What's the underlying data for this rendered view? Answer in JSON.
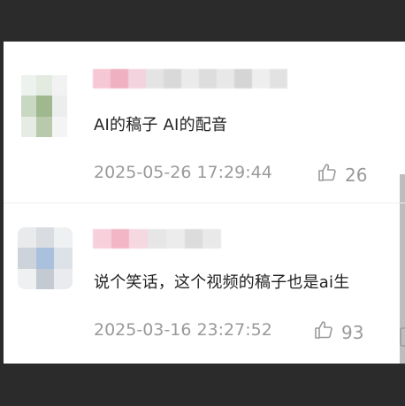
{
  "comments": [
    {
      "text": "AI的稿子 AI的配音",
      "timestamp": "2025-05-26 17:29:44",
      "likes": "26",
      "avatar_colors": [
        "#eef2ee",
        "#e3eadf",
        "#f2f2f2",
        "#c9d8c3",
        "#9fb88d",
        "#eceeed",
        "#e6ece4",
        "#b8c9ac",
        "#f4f4f4"
      ],
      "name_colors": [
        "#f6c7d4",
        "#efb0c2",
        "#f3d3dd",
        "#e4e4e4",
        "#d9d9d9",
        "#ebebeb",
        "#dddddd",
        "#e8e8e8",
        "#d5d5d5",
        "#eeeeee",
        "#e2e2e2"
      ]
    },
    {
      "text": "说个笑话，这个视频的稿子也是ai生",
      "timestamp": "2025-03-16 23:27:52",
      "likes": "93",
      "avatar_colors": [
        "#e8eaec",
        "#d9dde2",
        "#eff0f2",
        "#cdd3da",
        "#a9c1de",
        "#dde2e8",
        "#eef0f2",
        "#c4cad1",
        "#e9ebee"
      ],
      "name_colors": [
        "#f8d0dc",
        "#f2b6c7",
        "#f6d8e1",
        "#e6e6e6",
        "#ececec",
        "#dcdcdc",
        "#e9e9e9"
      ]
    }
  ]
}
